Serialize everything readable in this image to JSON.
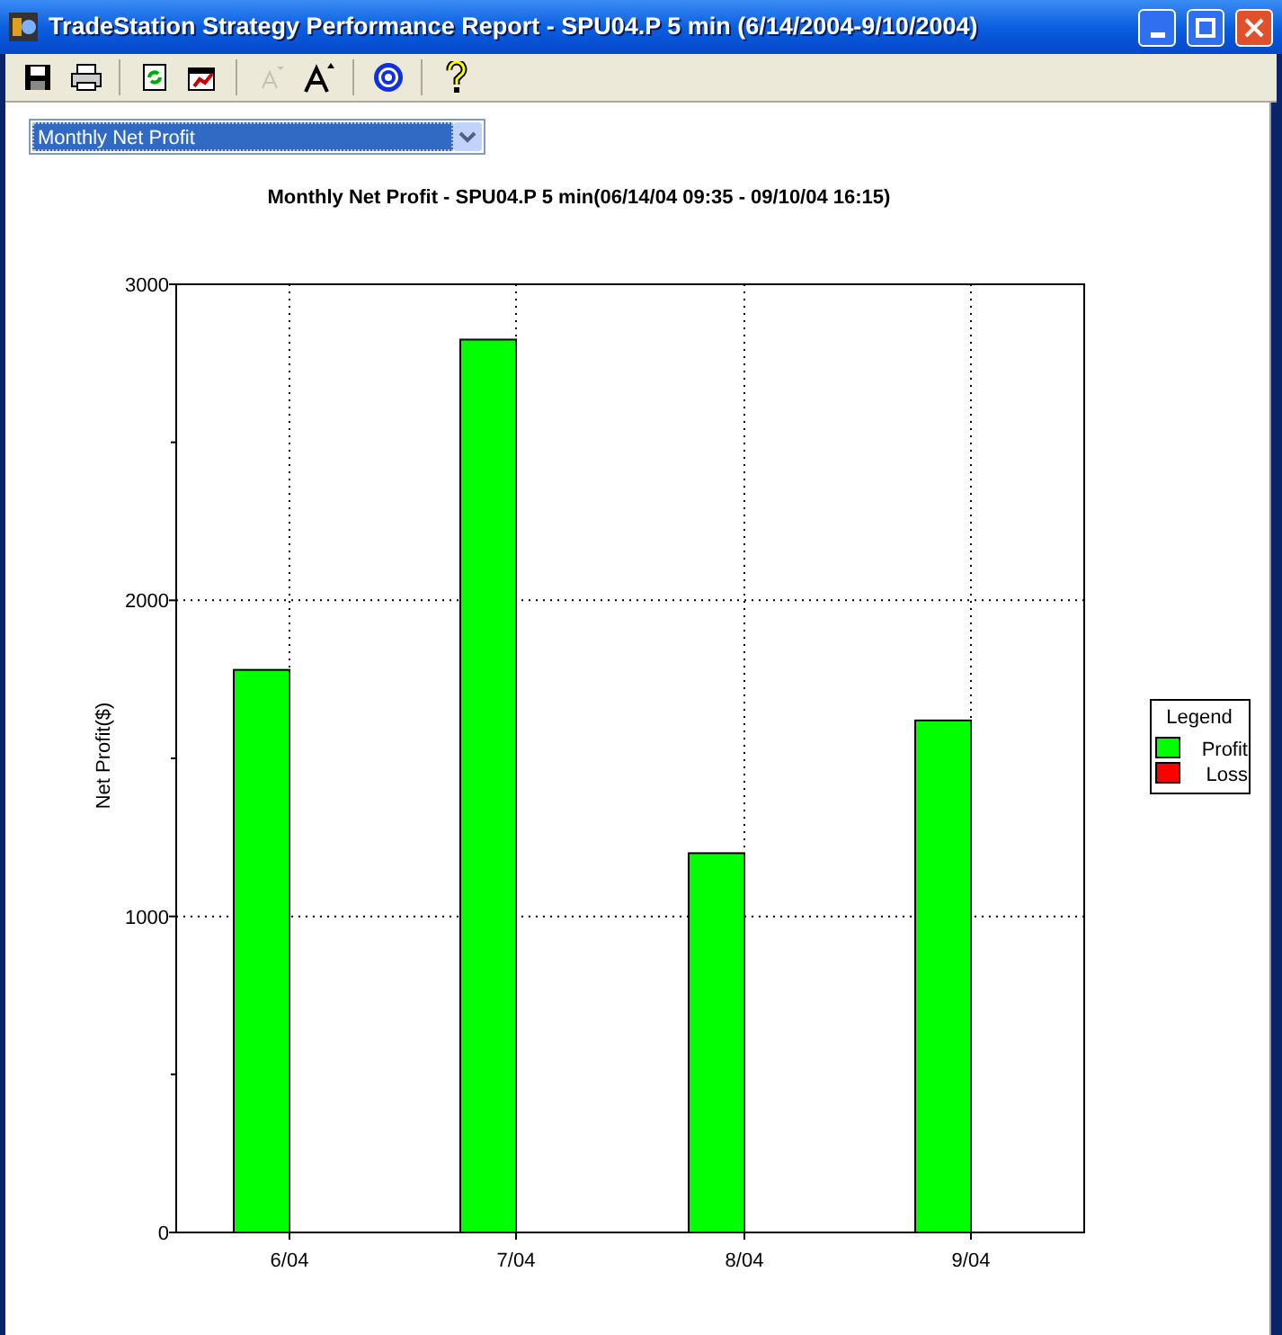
{
  "window": {
    "title": "TradeStation Strategy Performance Report - SPU04.P 5 min (6/14/2004-9/10/2004)"
  },
  "toolbar": [
    {
      "kind": "save",
      "disabled": false
    },
    {
      "kind": "print",
      "disabled": false
    },
    {
      "kind": "sep"
    },
    {
      "kind": "refresh",
      "disabled": false
    },
    {
      "kind": "export",
      "disabled": false
    },
    {
      "kind": "sep"
    },
    {
      "kind": "font-smaller",
      "disabled": true
    },
    {
      "kind": "font-larger",
      "disabled": false
    },
    {
      "kind": "sep"
    },
    {
      "kind": "target",
      "disabled": false
    },
    {
      "kind": "sep"
    },
    {
      "kind": "help",
      "disabled": false
    }
  ],
  "report_select": {
    "value": "Monthly Net Profit"
  },
  "chart": {
    "chart_data": {
      "type": "bar",
      "title": "Monthly Net Profit - SPU04.P 5 min(06/14/04 09:35 - 09/10/04 16:15)",
      "ylabel": "Net Profit($)",
      "categories": [
        "6/04",
        "7/04",
        "8/04",
        "9/04"
      ],
      "series": [
        {
          "name": "Profit",
          "color": "#00ff00",
          "values": [
            1780,
            2825,
            1200,
            1620
          ]
        },
        {
          "name": "Loss",
          "color": "#ff0000",
          "values": [
            null,
            null,
            null,
            null
          ]
        }
      ],
      "ylim": [
        0,
        3000
      ],
      "yticks": [
        0,
        1000,
        2000,
        3000
      ],
      "grid": true
    }
  },
  "legend": {
    "title": "Legend"
  }
}
